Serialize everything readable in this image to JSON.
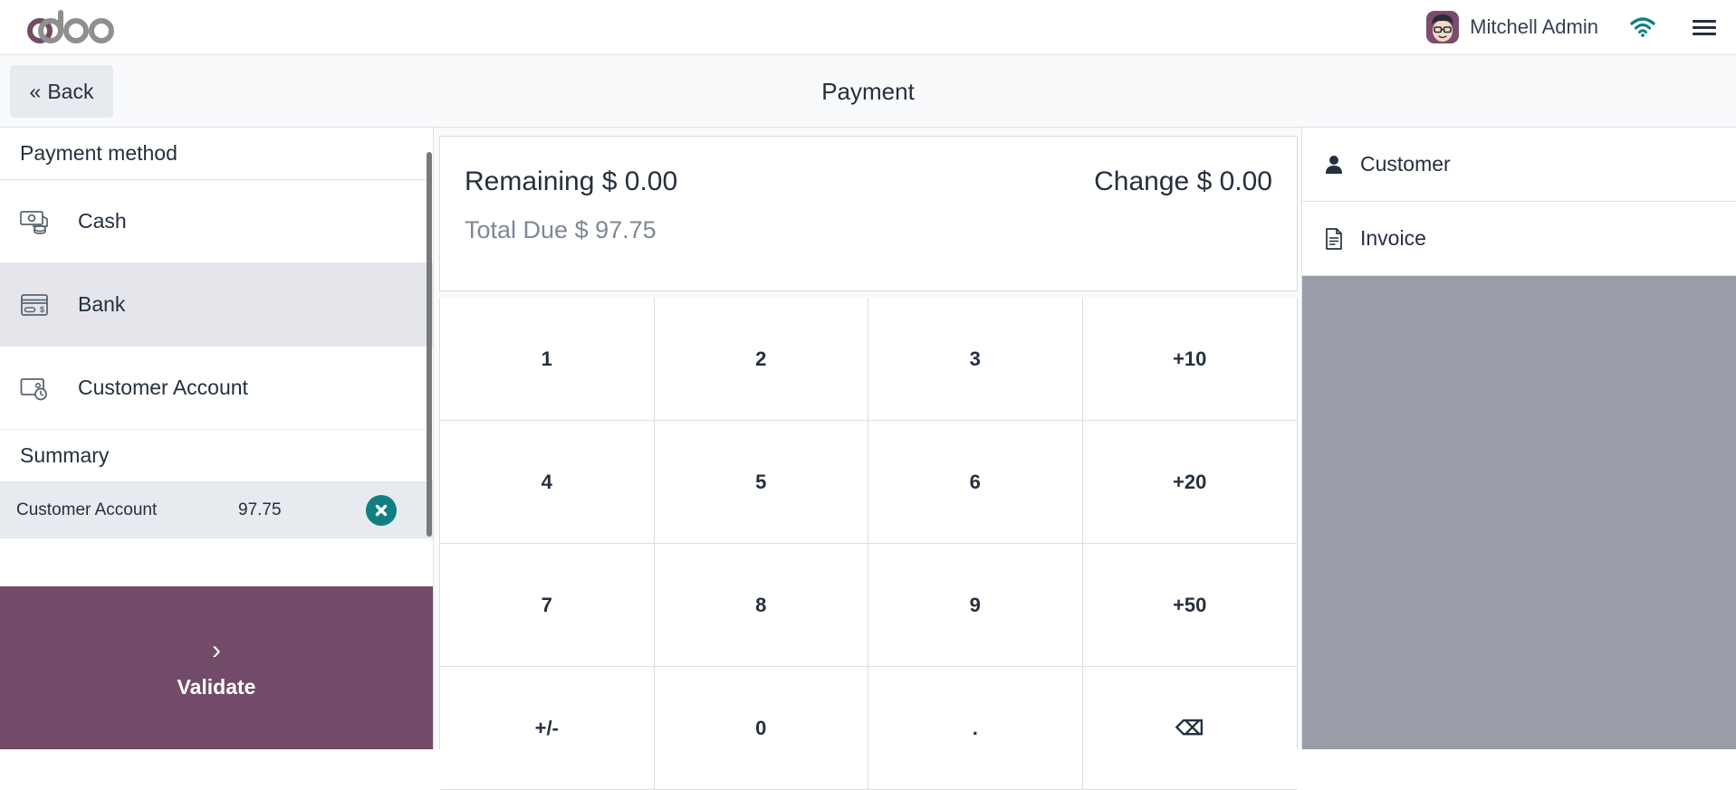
{
  "topbar": {
    "logo_text": "odoo",
    "logo_color_primary": "#714B67",
    "logo_color_secondary": "#8F8F8F",
    "username": "Mitchell Admin",
    "avatar_name": "user-avatar",
    "wifi_icon": "wifi-icon",
    "wifi_color": "#107F80",
    "menu_icon": "hamburger-menu-icon"
  },
  "subheader": {
    "back_label": "Back",
    "back_chevrons": "«",
    "title": "Payment"
  },
  "left_panel": {
    "payment_method_title": "Payment method",
    "methods": [
      {
        "label": "Cash",
        "icon": "cash-icon",
        "selected": false
      },
      {
        "label": "Bank",
        "icon": "credit-card-icon",
        "selected": true
      },
      {
        "label": "Customer Account",
        "icon": "wallet-clock-icon",
        "selected": false
      }
    ],
    "summary_title": "Summary",
    "summary_lines": [
      {
        "name": "Customer Account",
        "amount": "97.75",
        "delete_icon": "close-circle-icon"
      }
    ],
    "validate_label": "Validate",
    "validate_chevron": "›",
    "validate_color": "#714B67",
    "delete_button_color": "#107F80"
  },
  "center_panel": {
    "remaining_label": "Remaining",
    "remaining_value": "$ 0.00",
    "change_label": "Change",
    "change_value": "$ 0.00",
    "total_due_label": "Total Due",
    "total_due_value": "$ 97.75",
    "numpad": [
      {
        "label": "1",
        "name": "numpad-key-1"
      },
      {
        "label": "2",
        "name": "numpad-key-2"
      },
      {
        "label": "3",
        "name": "numpad-key-3"
      },
      {
        "label": "+10",
        "name": "numpad-key-plus10"
      },
      {
        "label": "4",
        "name": "numpad-key-4"
      },
      {
        "label": "5",
        "name": "numpad-key-5"
      },
      {
        "label": "6",
        "name": "numpad-key-6"
      },
      {
        "label": "+20",
        "name": "numpad-key-plus20"
      },
      {
        "label": "7",
        "name": "numpad-key-7"
      },
      {
        "label": "8",
        "name": "numpad-key-8"
      },
      {
        "label": "9",
        "name": "numpad-key-9"
      },
      {
        "label": "+50",
        "name": "numpad-key-plus50"
      },
      {
        "label": "+/-",
        "name": "numpad-key-sign"
      },
      {
        "label": "0",
        "name": "numpad-key-0"
      },
      {
        "label": ".",
        "name": "numpad-key-decimal"
      },
      {
        "label": "⌫",
        "name": "numpad-key-backspace"
      }
    ]
  },
  "right_panel": {
    "items": [
      {
        "label": "Customer",
        "icon": "person-icon"
      },
      {
        "label": "Invoice",
        "icon": "document-icon"
      }
    ],
    "filler_color": "#9A9DA8"
  }
}
